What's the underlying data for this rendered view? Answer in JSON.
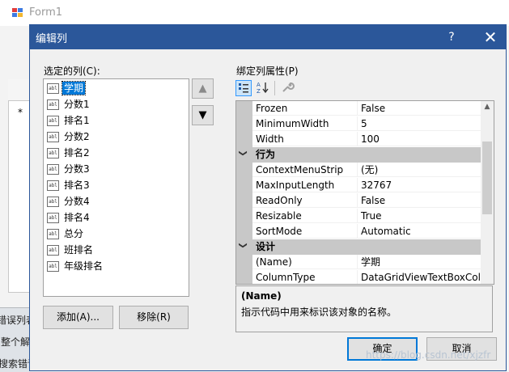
{
  "background_window": {
    "title": "Form1",
    "row_marker": "*",
    "bottom_strip_lines": [
      "错误列表",
      "整个解",
      "搜索错误"
    ]
  },
  "dialog": {
    "title": "编辑列",
    "help_label": "?",
    "close_label": "✕",
    "selected_columns_label": "选定的列(C):",
    "columns": [
      {
        "label": "学期",
        "type_icon": "abl",
        "selected": true
      },
      {
        "label": "分数1",
        "type_icon": "abl"
      },
      {
        "label": "排名1",
        "type_icon": "abl"
      },
      {
        "label": "分数2",
        "type_icon": "abl"
      },
      {
        "label": "排名2",
        "type_icon": "abl"
      },
      {
        "label": "分数3",
        "type_icon": "abl"
      },
      {
        "label": "排名3",
        "type_icon": "abl"
      },
      {
        "label": "分数4",
        "type_icon": "abl"
      },
      {
        "label": "排名4",
        "type_icon": "abl"
      },
      {
        "label": "总分",
        "type_icon": "abl"
      },
      {
        "label": "班排名",
        "type_icon": "abl"
      },
      {
        "label": "年级排名",
        "type_icon": "abl"
      }
    ],
    "move_up_icon": "▲",
    "move_down_icon": "▼",
    "add_button": "添加(A)...",
    "remove_button": "移除(R)",
    "bound_properties_label": "绑定列属性(P)",
    "toolbar": {
      "categorized_icon": "categorized-icon",
      "alphabetical_icon": "alphabetical-icon",
      "property_pages_icon": "wrench-icon"
    },
    "property_rows": [
      {
        "kind": "prop",
        "name": "Frozen",
        "value": "False"
      },
      {
        "kind": "prop",
        "name": "MinimumWidth",
        "value": "5"
      },
      {
        "kind": "prop",
        "name": "Width",
        "value": "100"
      },
      {
        "kind": "category",
        "name": "行为"
      },
      {
        "kind": "prop",
        "name": "ContextMenuStrip",
        "value": "(无)"
      },
      {
        "kind": "prop",
        "name": "MaxInputLength",
        "value": "32767"
      },
      {
        "kind": "prop",
        "name": "ReadOnly",
        "value": "False"
      },
      {
        "kind": "prop",
        "name": "Resizable",
        "value": "True"
      },
      {
        "kind": "prop",
        "name": "SortMode",
        "value": "Automatic"
      },
      {
        "kind": "category",
        "name": "设计"
      },
      {
        "kind": "prop",
        "name": "(Name)",
        "value": "学期"
      },
      {
        "kind": "prop",
        "name": "ColumnType",
        "value": "DataGridViewTextBoxColumn"
      }
    ],
    "description_title": "(Name)",
    "description_text": "指示代码中用来标识该对象的名称。",
    "ok_button": "确定",
    "cancel_button": "取消",
    "accent_color": "#2b579a",
    "selection_color": "#0078d7"
  },
  "watermark": "https://blog.csdn.net/xjzfr"
}
